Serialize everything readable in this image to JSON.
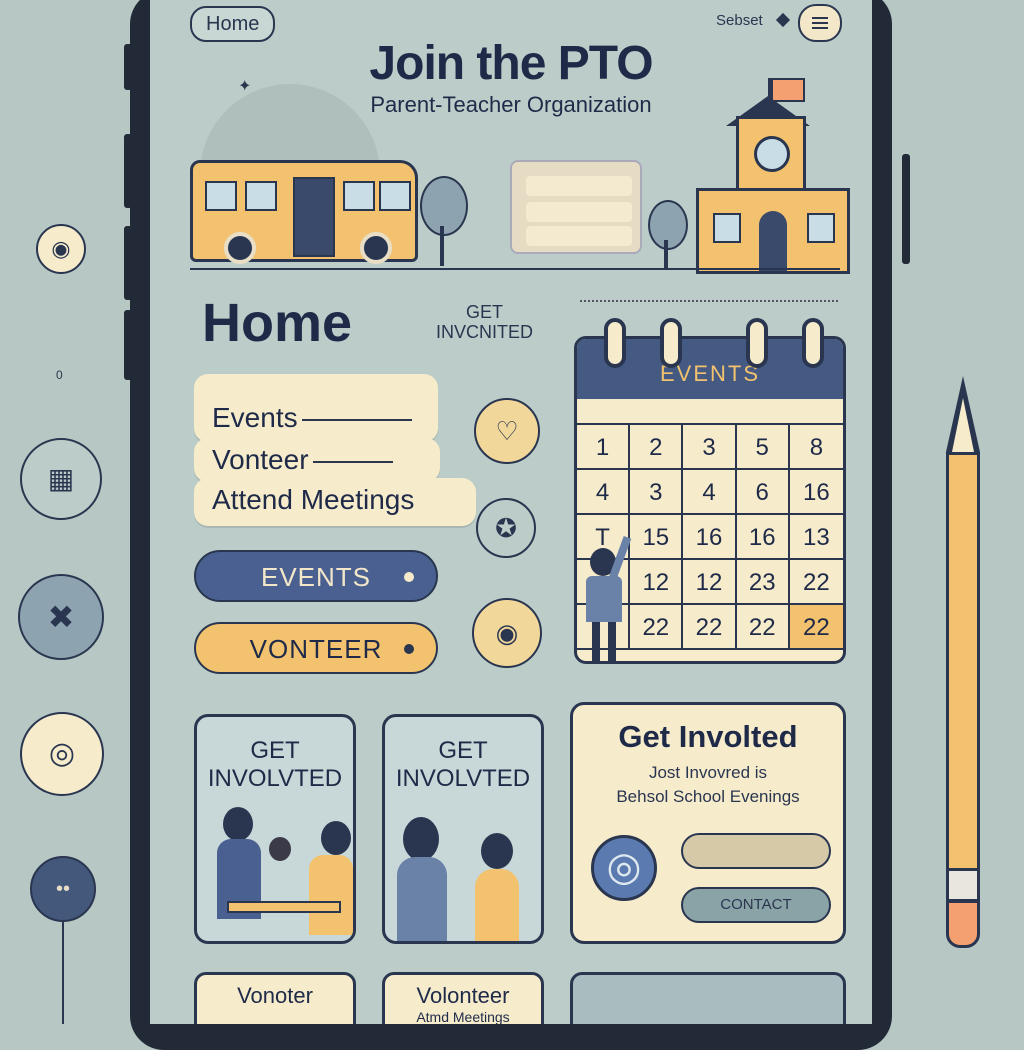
{
  "topbar": {
    "home_label": "Home",
    "select_label": "Sebset"
  },
  "header": {
    "title": "Join the PTO",
    "subtitle": "Parent-Teacher Organization"
  },
  "hero": {
    "sign_lines": [
      "",
      "",
      ""
    ]
  },
  "main": {
    "heading": "Home",
    "get_involved_line1": "GET",
    "get_involved_line2": "INVCNITED",
    "menu_items": [
      "Events",
      "Vonteer",
      "Attend Meetings"
    ],
    "events_button": "EVENTS",
    "volunteer_button": "VONTEER"
  },
  "calendar": {
    "title": "EVENTS",
    "day_labels": [
      "",
      "",
      "",
      "",
      ""
    ],
    "days": [
      "1",
      "2",
      "3",
      "5",
      "8",
      "4",
      "3",
      "4",
      "6",
      "16",
      "T",
      "15",
      "16",
      "16",
      "13",
      "",
      "12",
      "12",
      "23",
      "22",
      "",
      "22",
      "22",
      "22",
      "22"
    ]
  },
  "cards": [
    {
      "title_line1": "GET",
      "title_line2": "INVOLVTED"
    },
    {
      "title_line1": "GET",
      "title_line2": "INVOLVTED"
    }
  ],
  "get_involved_card": {
    "title": "Get Involted",
    "line1": "Jost Invovred is",
    "line2": "Behsol School Evenings",
    "button1": "",
    "button2": "CONTACT"
  },
  "bottom_cards": [
    {
      "title": "Vonoter",
      "sub": ""
    },
    {
      "title": "Volonteer",
      "sub": "Atmd Meetings"
    },
    {
      "title": "",
      "sub": ""
    }
  ],
  "colors": {
    "background": "#b7c8c4",
    "navy": "#2a3650",
    "cream": "#f6eccc",
    "yellow": "#f2c26e",
    "blue_button": "#4a6090"
  },
  "icons": [
    "menu-icon",
    "compass-icon",
    "pin-icon",
    "globe-icon",
    "pencil-icon",
    "heart-icon"
  ]
}
